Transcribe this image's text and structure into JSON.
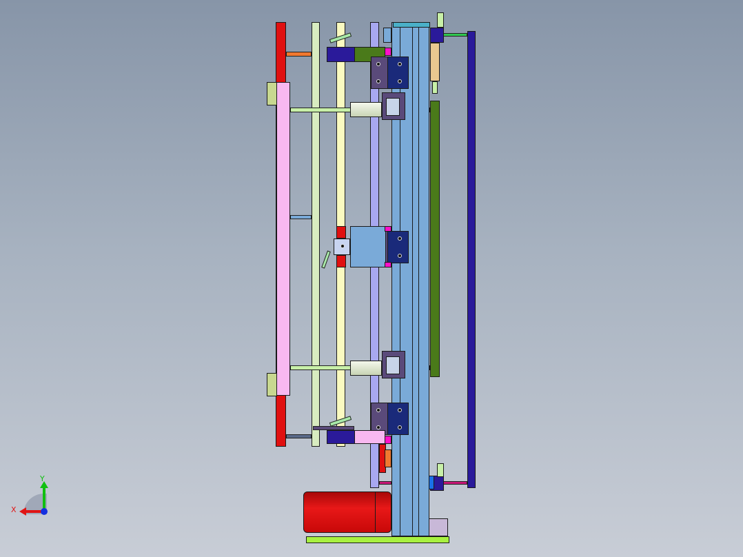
{
  "viewer": {
    "background_top": "#8795a8",
    "background_bottom": "#c8cdd6"
  },
  "triad": {
    "x_label": "X",
    "y_label": "Y",
    "x_color": "#e01515",
    "y_color": "#10c010",
    "z_color": "#1530e0"
  },
  "model": {
    "part_colors": {
      "red_plate": "#e01010",
      "pink_plate": "#f8b8f0",
      "green_plate": "#4a7a1a",
      "navy_plate": "#2a1a9a",
      "blue_column": "#7aaad8",
      "motor": "#d81010",
      "base": "#a8f040",
      "lavender_rail": "#a8a8f0",
      "yellow_rail": "#fafac0",
      "pale_green_rail": "#d8ecc0",
      "block_dark": "#5a4a7a",
      "block_navy": "#1a2a7a",
      "magenta": "#ff10c8"
    }
  }
}
